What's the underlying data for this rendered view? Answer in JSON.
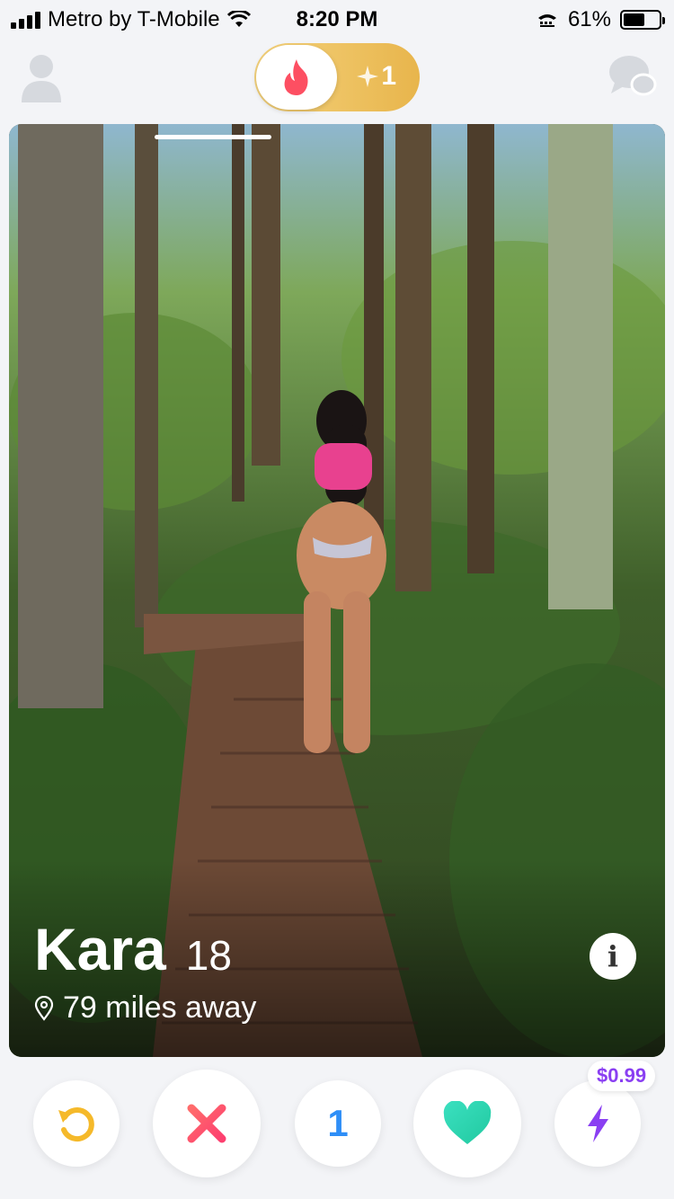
{
  "status_bar": {
    "carrier": "Metro by T-Mobile",
    "time": "8:20 PM",
    "battery_percent": "61%",
    "battery_level": 0.61
  },
  "top_bar": {
    "boost_count": "1",
    "icons": [
      "profile-icon",
      "flame-icon",
      "sparkle-icon",
      "chat-icon"
    ],
    "colors": {
      "flame": "#fd4f62",
      "toggle": "#e9b94f",
      "icon_gray": "#d6d9de"
    }
  },
  "card": {
    "name": "Kara",
    "age": "18",
    "distance": "79 miles away",
    "icons": [
      "location-pin-icon",
      "info-icon"
    ]
  },
  "actions": {
    "super_like_count": "1",
    "boost_price": "$0.99",
    "icons": [
      "rewind-icon",
      "nope-icon",
      "like-heart-icon",
      "boost-bolt-icon"
    ],
    "colors": {
      "rewind": "#f5b92a",
      "nope": "#ff4d5f",
      "super_like": "#2e8ef7",
      "like": "#2fd5b0",
      "boost": "#8a3ff2"
    }
  }
}
